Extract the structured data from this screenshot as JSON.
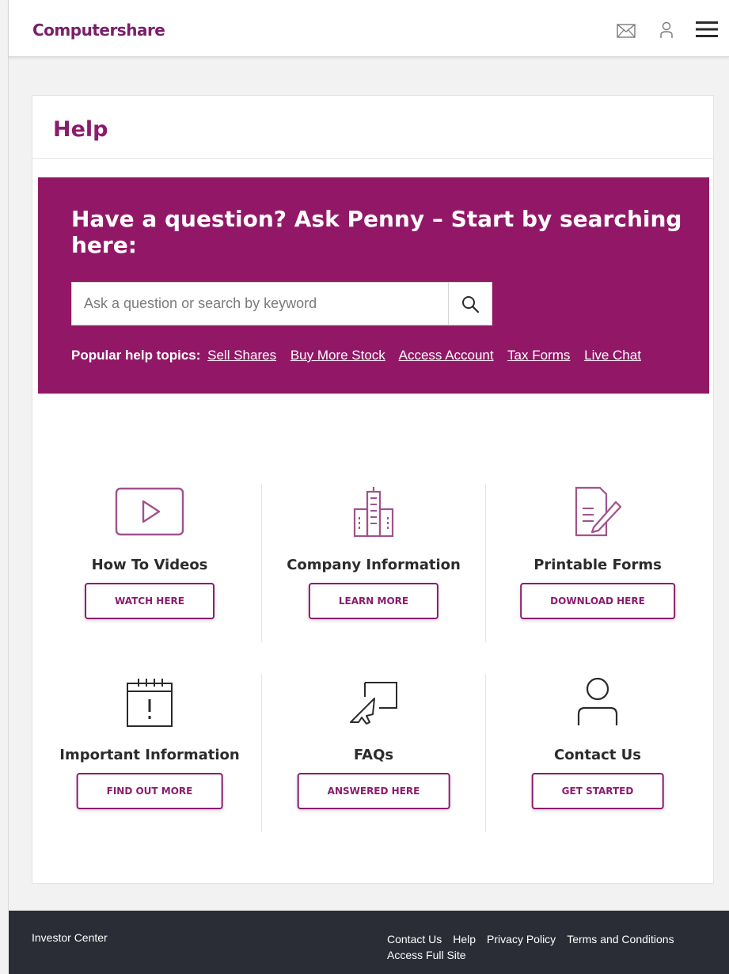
{
  "header": {
    "logo": "Computershare",
    "icons": [
      "mail-icon",
      "user-icon",
      "menu-icon"
    ]
  },
  "page": {
    "title": "Help"
  },
  "hero": {
    "title": "Have a question? Ask Penny – Start by searching here:",
    "search_placeholder": "Ask a question or search by keyword",
    "search_value": "",
    "topics_label": "Popular help topics:",
    "topics": [
      "Sell Shares",
      "Buy More Stock",
      "Access Account",
      "Tax Forms",
      "Live Chat"
    ]
  },
  "tiles": [
    {
      "label": "How To Videos",
      "button": "WATCH HERE",
      "icon": "video-play-icon"
    },
    {
      "label": "Company Information",
      "button": "LEARN MORE",
      "icon": "building-icon"
    },
    {
      "label": "Printable Forms",
      "button": "DOWNLOAD HERE",
      "icon": "form-pen-icon"
    },
    {
      "label": "Important Information",
      "button": "FIND OUT MORE",
      "icon": "calendar-alert-icon"
    },
    {
      "label": "FAQs",
      "button": "ANSWERED HERE",
      "icon": "cursor-screen-icon"
    },
    {
      "label": "Contact Us",
      "button": "GET STARTED",
      "icon": "person-icon"
    }
  ],
  "footer": {
    "brand": "Investor Center",
    "links": [
      "Contact Us",
      "Help",
      "Privacy Policy",
      "Terms and Conditions",
      "Access Full Site"
    ]
  },
  "colors": {
    "brand": "#921867",
    "accent": "#8a1c6e",
    "footer": "#2a2d35"
  }
}
